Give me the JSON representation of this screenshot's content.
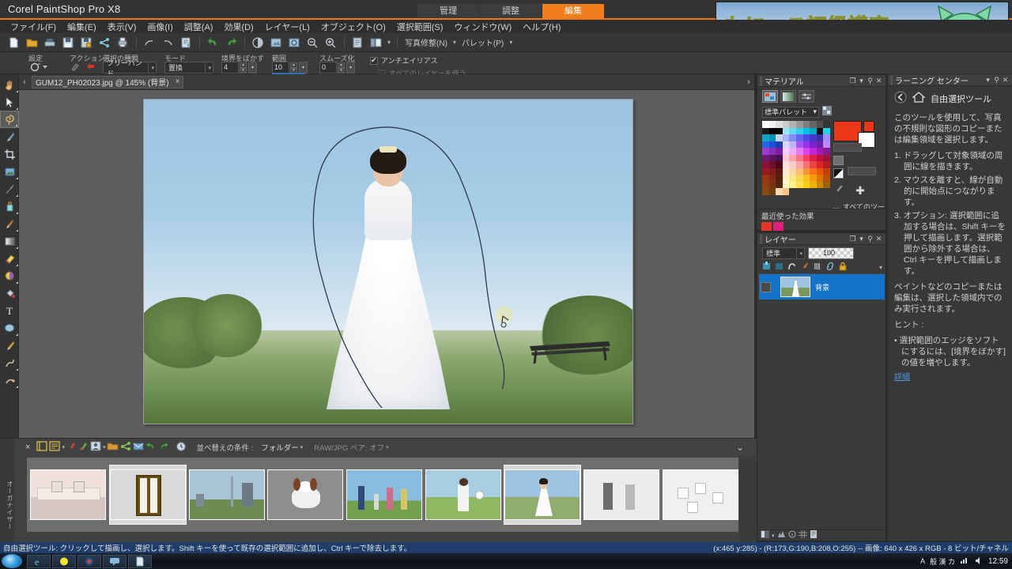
{
  "app": {
    "title": "Corel PaintShop Pro X8",
    "top_tabs": [
      {
        "label": "管理",
        "active": false
      },
      {
        "label": "調整",
        "active": false
      },
      {
        "label": "編集",
        "active": true
      }
    ]
  },
  "overlay": {
    "text": "もにっこ初級講座",
    "mascot": "cat-face-icon",
    "text_color": "#fbf46a"
  },
  "menu": {
    "items": [
      {
        "label": "ファイル(F)"
      },
      {
        "label": "編集(E)"
      },
      {
        "label": "表示(V)"
      },
      {
        "label": "画像(I)"
      },
      {
        "label": "調整(A)"
      },
      {
        "label": "効果(D)"
      },
      {
        "label": "レイヤー(L)"
      },
      {
        "label": "オブジェクト(O)"
      },
      {
        "label": "選択範囲(S)"
      },
      {
        "label": "ウィンドウ(W)"
      },
      {
        "label": "ヘルプ(H)"
      }
    ]
  },
  "toolbar": {
    "icons": [
      "new-file-icon",
      "open-folder-icon",
      "scanner-icon",
      "save-icon",
      "save-as-icon",
      "share-icon",
      "print-icon",
      "undo-arc-icon",
      "redo-arc-icon",
      "copy-to-icon",
      "undo-icon",
      "redo-icon",
      "histogram-icon",
      "resize-image-icon",
      "rotate-icon",
      "zoom-out-icon",
      "zoom-in-icon",
      "script-icon",
      "workspace-icon"
    ],
    "photo_repair_label": "写真修整(N)",
    "palette_label": "パレット(P)"
  },
  "tool_options": {
    "preset_label": "設定",
    "preset_icon": "preset-dropdown-icon",
    "action_label": "アクション",
    "action_icons": [
      "action-icon-1",
      "action-icon-2"
    ],
    "selection_type_label": "選択の種類",
    "selection_type_value": "フリーハンド",
    "mode_label": "モード",
    "mode_value": "置換",
    "feather_label": "境界をぼかす",
    "feather_value": "4",
    "range_label": "範囲",
    "range_value": "10",
    "smooth_label": "スムーズ化",
    "smooth_value": "0",
    "antialias_label": "アンチエイリアス",
    "antialias_checked": true,
    "all_layers_label": "すべてのレイヤーを使う",
    "all_layers_checked": false
  },
  "tools_palette": {
    "items": [
      {
        "name": "pan-tool",
        "icon": "hand-icon",
        "selected": false,
        "has_flyout": true
      },
      {
        "name": "pick-tool",
        "icon": "arrow-pointer-icon",
        "selected": false,
        "has_flyout": true
      },
      {
        "name": "freehand-selection-tool",
        "icon": "lasso-selection-icon",
        "selected": true,
        "has_flyout": true
      },
      {
        "name": "paint-brush-tool",
        "icon": "paintbrush-icon",
        "selected": false,
        "has_flyout": false
      },
      {
        "name": "crop-tool",
        "icon": "crop-icon",
        "selected": false,
        "has_flyout": false
      },
      {
        "name": "text-bg-tool",
        "icon": "picture-frame-icon",
        "selected": false,
        "has_flyout": true
      },
      {
        "name": "dropper-tool",
        "icon": "eyedropper-icon",
        "selected": false,
        "has_flyout": true
      },
      {
        "name": "makeover-tool",
        "icon": "makeover-icon",
        "selected": false,
        "has_flyout": true
      },
      {
        "name": "clone-brush-tool",
        "icon": "clone-brush-icon",
        "selected": false,
        "has_flyout": true
      },
      {
        "name": "gradient-tool",
        "icon": "gradient-icon",
        "selected": false,
        "has_flyout": true
      },
      {
        "name": "eraser-tool",
        "icon": "eraser-icon",
        "selected": false,
        "has_flyout": true
      },
      {
        "name": "color-changer-tool",
        "icon": "color-changer-icon",
        "selected": false,
        "has_flyout": true
      },
      {
        "name": "fill-tool",
        "icon": "paint-bucket-icon",
        "selected": false,
        "has_flyout": false
      },
      {
        "name": "text-tool",
        "icon": "text-t-icon",
        "selected": false,
        "has_flyout": false
      },
      {
        "name": "shape-tool",
        "icon": "ellipse-shape-icon",
        "selected": false,
        "has_flyout": true
      },
      {
        "name": "pen-tool",
        "icon": "pen-icon",
        "selected": false,
        "has_flyout": false
      },
      {
        "name": "warp-brush-tool",
        "icon": "warp-brush-icon",
        "selected": false,
        "has_flyout": true
      },
      {
        "name": "mesh-warp-tool",
        "icon": "mesh-warp-icon",
        "selected": false,
        "has_flyout": true
      }
    ]
  },
  "document": {
    "tab_label": "GUM12_PH02023.jpg @ 145% (背景)",
    "close_glyph": "×",
    "prev_glyph": "‹",
    "next_glyph": "›"
  },
  "materials": {
    "title": "マテリアル",
    "palette_name": "標準パレット",
    "all_tools_label": "すべてのツール",
    "all_tools_checked": true,
    "foreground_color": "#ed3817",
    "background_color": "#ffffff",
    "tabs": [
      "color-wheel-tab",
      "gradient-tab",
      "sliders-tab"
    ],
    "swatch_colors": [
      "#ffffff",
      "#f2f2f2",
      "#e0e0e0",
      "#cccccc",
      "#b3b3b3",
      "#999999",
      "#808080",
      "#666666",
      "#4d4d4d",
      "#333333",
      "#1a1a1a",
      "#000000",
      "#000000",
      "#99e6f2",
      "#66d9ef",
      "#33ccee",
      "#00bfe6",
      "#00a6cc",
      "#0d0d0d",
      "#22d3ee",
      "#0ea5c9",
      "#0891b2",
      "#c7d2fe",
      "#a5b4fc",
      "#818cf8",
      "#6366f1",
      "#4f46e5",
      "#4338ca",
      "#3730a3",
      "#a78bfa",
      "#2563eb",
      "#1d4ed8",
      "#1e40af",
      "#ddd6fe",
      "#c4b5fd",
      "#a855f7",
      "#9333ea",
      "#7e22ce",
      "#6b21a8",
      "#c084fc",
      "#9a3fcf",
      "#8b2fb8",
      "#7c1fa3",
      "#f5d0fe",
      "#f0abfc",
      "#e879f9",
      "#d946ef",
      "#c026d3",
      "#a21caf",
      "#86198f",
      "#701a75",
      "#5b145f",
      "#4a0f4d",
      "#fecdd3",
      "#fda4af",
      "#fb7185",
      "#f43f5e",
      "#e11d48",
      "#be123c",
      "#9f1239",
      "#881337",
      "#6b0f2a",
      "#4c0519",
      "#fee2e2",
      "#fecaca",
      "#fca5a5",
      "#f87171",
      "#ef4444",
      "#dc2626",
      "#b91c1c",
      "#991b1b",
      "#7f1d1d",
      "#601414",
      "#ffedd5",
      "#fed7aa",
      "#fdba74",
      "#fb923c",
      "#f97316",
      "#ea580c",
      "#c2410c",
      "#9a3412",
      "#7c2d12",
      "#5a1f0c",
      "#fef3c7",
      "#fde68a",
      "#fcd34d",
      "#fbbf24",
      "#f59e0b",
      "#d97706",
      "#b45309",
      "#92400e",
      "#78350f",
      "#57270b",
      "#fef9c3",
      "#fef08a",
      "#fde047",
      "#facc15",
      "#eab308",
      "#ca8a04",
      "#a16207",
      "#854d0e",
      "#713f12",
      "#ffd9b3",
      "#ffc285"
    ]
  },
  "recent_effects": {
    "title": "最近使った効果",
    "swatches": [
      "#e8352a",
      "#e01f7a"
    ]
  },
  "layers": {
    "title": "レイヤー",
    "blend_mode": "標準",
    "opacity": "100",
    "toolbar_icons": [
      "new-raster-layer-icon",
      "new-vector-layer-icon",
      "new-mask-layer-icon",
      "new-art-media-layer-icon",
      "delete-layer-icon",
      "link-layers-icon",
      "lock-layer-icon"
    ],
    "rows": [
      {
        "name": "背景",
        "selected": true,
        "visible": true
      }
    ]
  },
  "learning_center": {
    "title": "ラーニング センター",
    "back_icon": "back-arrow-icon",
    "home_icon": "home-icon",
    "topic": "自由選択ツール",
    "intro": "このツールを使用して、写真の不規則な図形のコピーまたは編集領域を選択します。",
    "steps": [
      "1. ドラッグして対象領域の周囲に線を描きます。",
      "2. マウスを離すと、線が自動的に開始点につながります。",
      "3. オプション: 選択範囲に追加する場合は、Shift キーを押して描画します。選択範囲から除外する場合は、Ctrl キーを押して描画します。"
    ],
    "note": "ペイントなどのコピーまたは編集は、選択した領域内でのみ実行されます。",
    "hint_label": "ヒント :",
    "hints": [
      "選択範囲のエッジをソフトにするには、[境界をぼかす] の値を増やします。"
    ],
    "more_link": "詳細"
  },
  "organizer": {
    "sort_label": "並べ替えの条件 :",
    "sort_value": "フォルダー",
    "rawjpg_label": "RAW/JPG ペア: オフ",
    "side_label": "オーガナイザー",
    "close_glyph": "×",
    "collapse_glyph": "⌄",
    "toolbar_icons": [
      "show-info-icon",
      "show-details-icon",
      "rating-icon",
      "tag-icon",
      "person-icon",
      "folder-icon",
      "share-icon",
      "email-icon",
      "rotate-left-icon",
      "rotate-right-icon",
      "time-icon"
    ],
    "thumbnails": [
      {
        "name": "interior-render",
        "selected": false
      },
      {
        "name": "wooden-door",
        "selected": false
      },
      {
        "name": "tokyo-skytree",
        "selected": false
      },
      {
        "name": "dog-on-pavement",
        "selected": false
      },
      {
        "name": "family-outdoors",
        "selected": false
      },
      {
        "name": "boy-with-ball",
        "selected": false
      },
      {
        "name": "bride-in-field",
        "selected": true
      },
      {
        "name": "couple-indoors",
        "selected": false
      },
      {
        "name": "white-cubes",
        "selected": false
      }
    ]
  },
  "status_bar": {
    "message": "自由選択ツール: クリックして描画し、選択します。Shift キーを使って既存の選択範囲に追加し、Ctrl キーで除去します。",
    "info": "(x:465 y:285) - (R:173,G:190,B:208,O:255) -- 画像:  640 x 426 x RGB - 8 ビット/チャネル"
  },
  "taskbar": {
    "start_icon": "windows-start-orb-icon",
    "items": [
      {
        "name": "internet-explorer-icon"
      },
      {
        "name": "yellow-app-icon"
      },
      {
        "name": "media-app-icon"
      },
      {
        "name": "chat-app-icon"
      },
      {
        "name": "document-app-icon"
      }
    ],
    "tray_ime": "A",
    "tray_labels": "般 漢 カ",
    "clock": "12:59"
  }
}
